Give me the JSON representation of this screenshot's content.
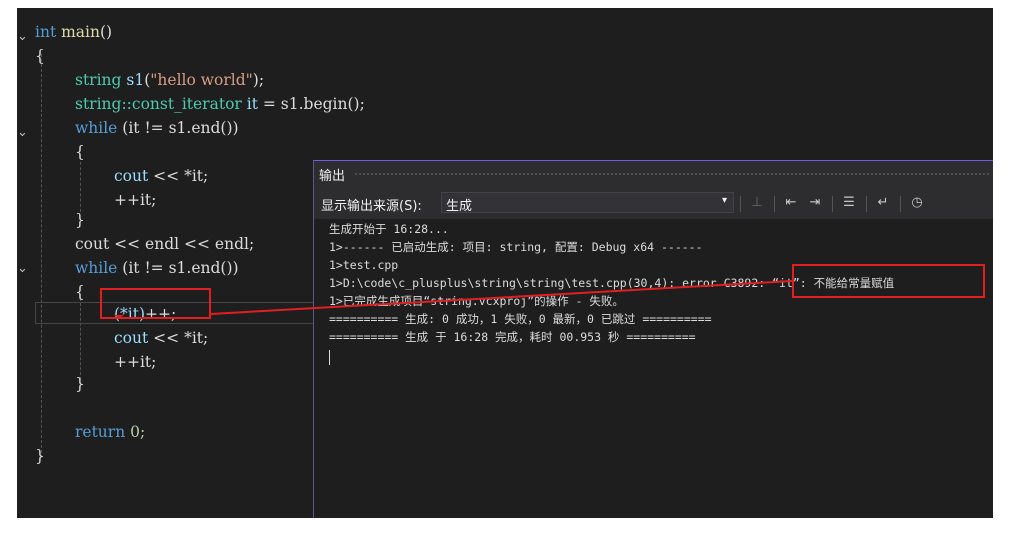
{
  "code": {
    "l1_kw": "int",
    "l1_fn": "main",
    "l1_paren": "()",
    "brace_open": "{",
    "brace_close": "}",
    "l3_type": "string",
    "l3_var": "s1",
    "l3_str": "\"hello world\"",
    "l4_type": "string::const_iterator",
    "l4_var": "it",
    "l4_rest": "s1.begin();",
    "while_kw": "while",
    "while_cond": "(it != s1.end())",
    "cout": "cout",
    "cout_it": "<< *it;",
    "inc_it": "++it;",
    "cout_endl": "cout << endl << endl;",
    "paren_it": "(*it)",
    "plusplus": "++;",
    "return_kw": "return",
    "return_val": "0;"
  },
  "output": {
    "title": "输出",
    "source_label": "显示输出来源(S):",
    "source_value": "生成",
    "lines": [
      "生成开始于 16:28...",
      "1>------ 已启动生成: 项目: string, 配置: Debug x64 ------",
      "1>test.cpp",
      "1>D:\\code\\c_plusplus\\string\\string\\test.cpp(30,4): error C3892: “it”: 不能给常量赋值",
      "1>已完成生成项目“string.vcxproj”的操作 - 失败。",
      "========== 生成: 0 成功，1 失败，0 最新，0 已跳过 ==========",
      "========== 生成 于 16:28 完成，耗时 00.953 秒 =========="
    ]
  },
  "annotation": {
    "boxed_error": "“it”: 不能给常量赋值"
  },
  "colors": {
    "editor_bg": "#1e1e1e",
    "keyword": "#569cd6",
    "type": "#4ec9b0",
    "string": "#d69d85",
    "annotation_red": "#e02020"
  }
}
